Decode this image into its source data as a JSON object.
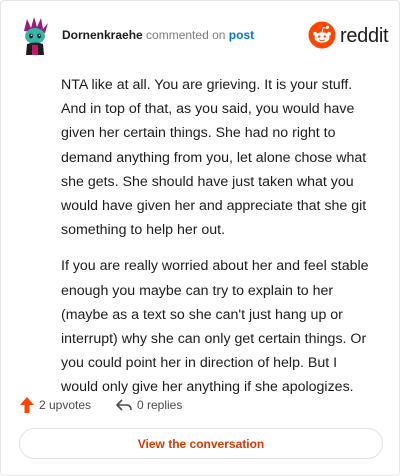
{
  "comment": {
    "author": "Dornenkraehe",
    "action_text": "commented on",
    "target_link": "post",
    "paragraphs": [
      "NTA like at all. You are grieving. It is your stuff. And in top of that, as you said, you would have given her certain things. She had no right to demand anything from you, let alone chose what she gets. She should have just taken what you would have given her and appreciate that she git something to help her out.",
      "If you are really worried about her and feel stable enough you maybe can try to explain to her (maybe as a text so she can't just hang up or interrupt) why she can only get certain things. Or you could point her in direction of help. But I would only give her anything if she apologizes."
    ]
  },
  "brand": {
    "name": "reddit",
    "icon": "reddit-logo-icon",
    "color": "#ff4500"
  },
  "footer": {
    "upvotes": "2 upvotes",
    "upvote_icon": "upvote-arrow-icon",
    "replies": "0 replies",
    "reply_icon": "reply-arrow-icon"
  },
  "cta": {
    "label": "View the conversation",
    "color": "#d93a00"
  },
  "colors": {
    "link": "#0079d3",
    "muted": "#7c7c7c",
    "accent": "#ff4500"
  }
}
